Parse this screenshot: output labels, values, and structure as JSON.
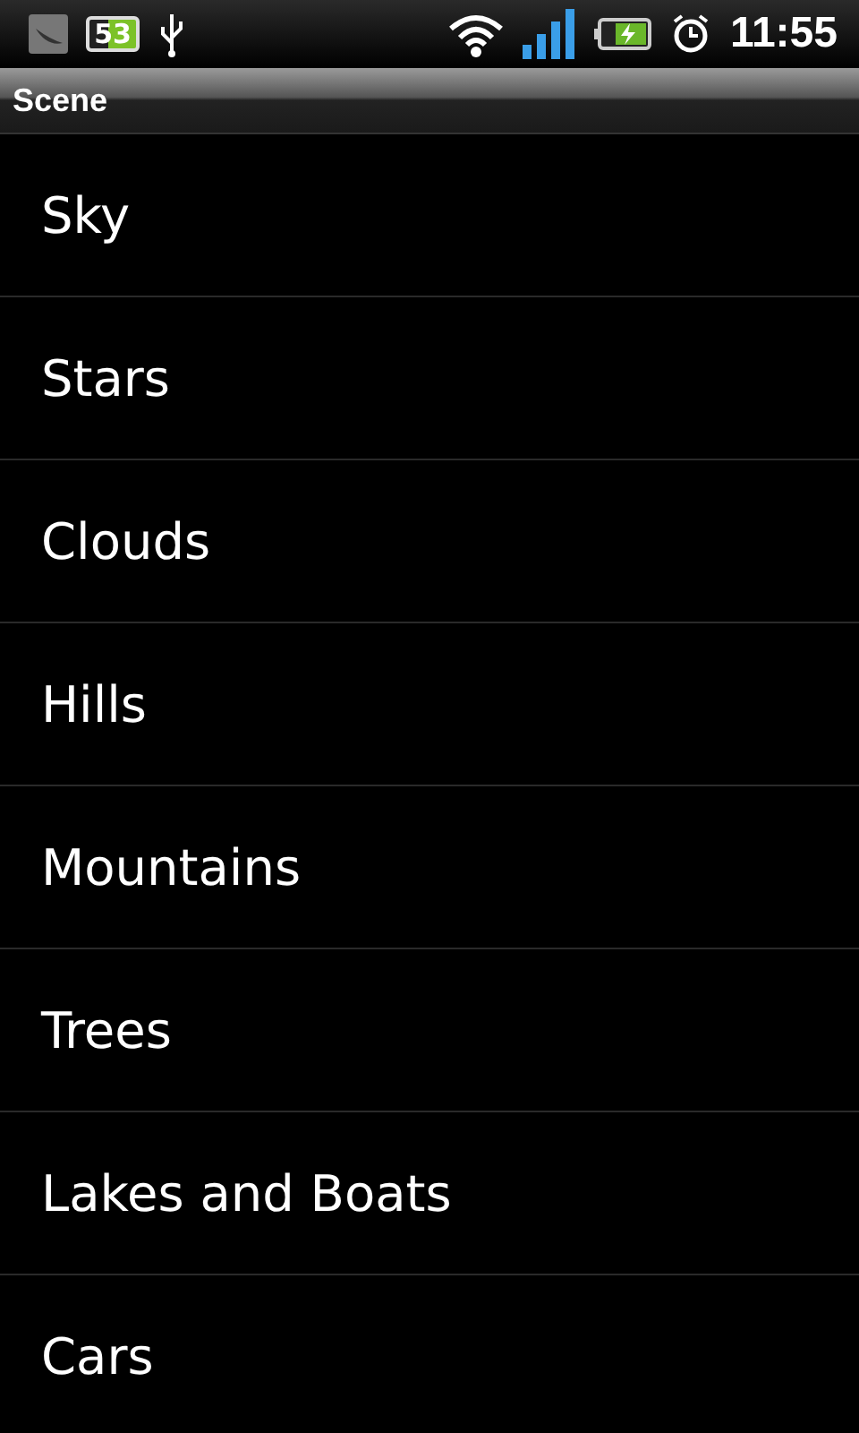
{
  "status_bar": {
    "battery_badge": "53",
    "time": "11:55"
  },
  "title_bar": {
    "title": "Scene"
  },
  "list": {
    "items": [
      {
        "label": "Sky"
      },
      {
        "label": "Stars"
      },
      {
        "label": "Clouds"
      },
      {
        "label": "Hills"
      },
      {
        "label": "Mountains"
      },
      {
        "label": "Trees"
      },
      {
        "label": "Lakes and Boats"
      },
      {
        "label": "Cars"
      }
    ]
  }
}
